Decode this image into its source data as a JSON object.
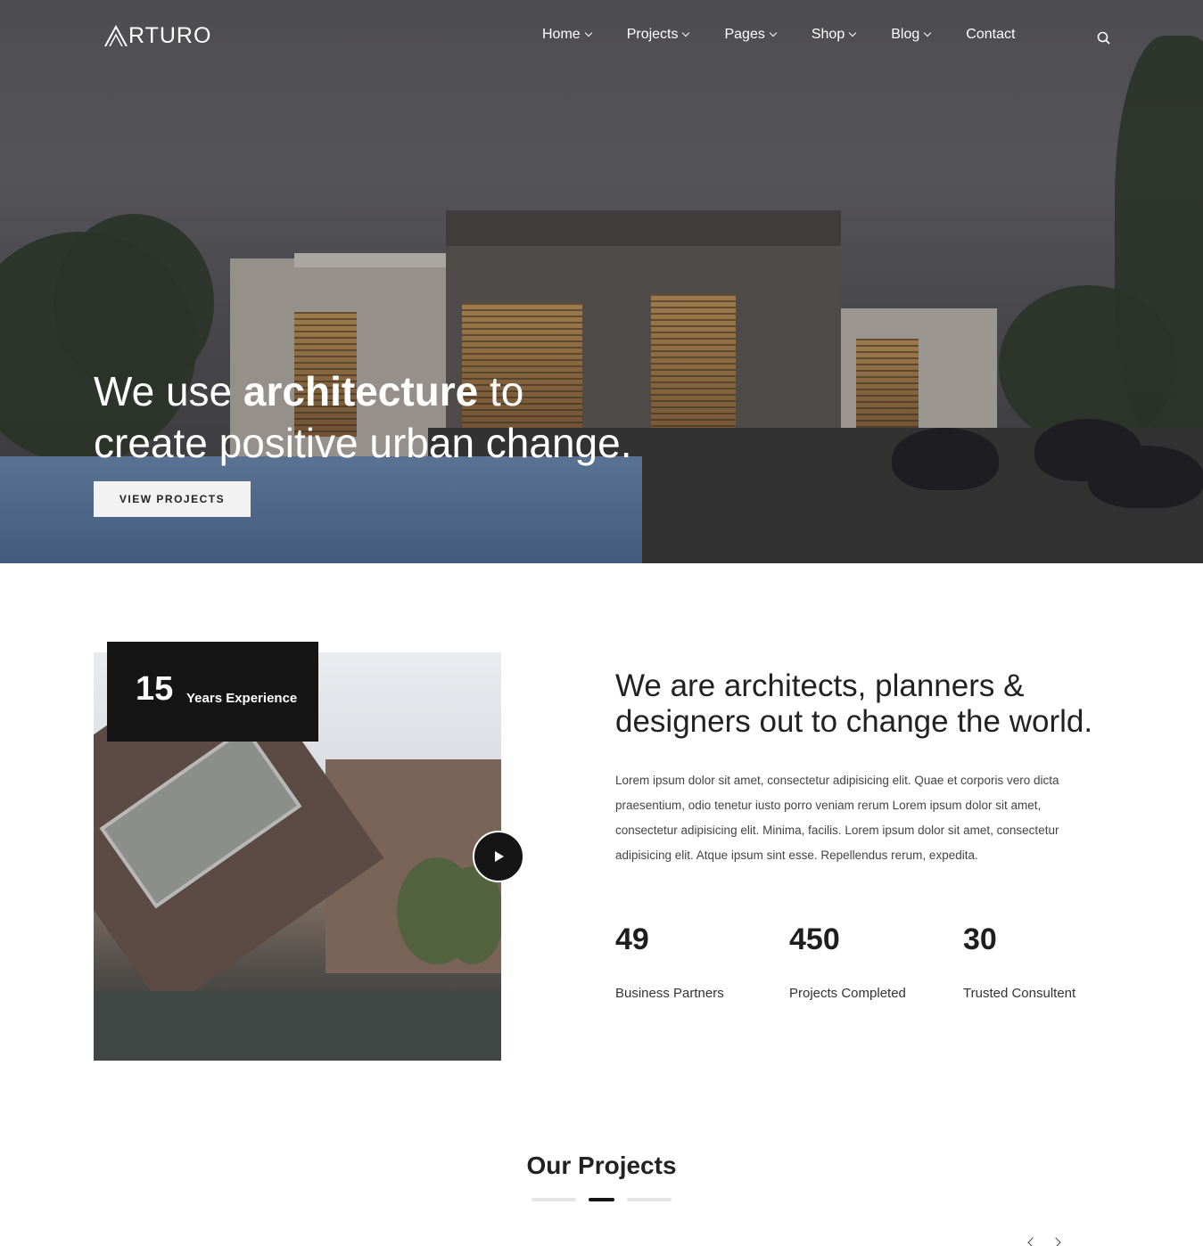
{
  "brand": {
    "logo_text": "RTURO"
  },
  "nav": {
    "items": [
      {
        "label": "Home",
        "has_dropdown": true
      },
      {
        "label": "Projects",
        "has_dropdown": true
      },
      {
        "label": "Pages",
        "has_dropdown": true
      },
      {
        "label": "Shop",
        "has_dropdown": true
      },
      {
        "label": "Blog",
        "has_dropdown": true
      },
      {
        "label": "Contact",
        "has_dropdown": false
      }
    ],
    "search_icon": "search-icon"
  },
  "hero": {
    "title_part1": "We use ",
    "title_bold": "architecture",
    "title_part2": " to",
    "title_line2": "create positive urban change.",
    "button_label": "VIEW PROJECTS"
  },
  "about": {
    "experience_number": "15",
    "experience_label": "Years Experience",
    "heading": "We are architects, planners & designers out to change the world.",
    "body": "Lorem ipsum dolor sit amet, consectetur adipisicing elit. Quae et corporis vero dicta praesentium, odio tenetur iusto porro veniam rerum Lorem ipsum dolor sit amet, consectetur adipisicing elit. Minima, facilis. Lorem ipsum dolor sit amet, consectetur adipisicing elit. Atque ipsum sint esse. Repellendus rerum, expedita.",
    "play_icon": "play-icon",
    "stats": [
      {
        "number": "49",
        "label": "Business Partners"
      },
      {
        "number": "450",
        "label": "Projects Completed"
      },
      {
        "number": "30",
        "label": "Trusted Consultent"
      }
    ]
  },
  "projects": {
    "title": "Our Projects",
    "slider_active_index": 1,
    "slider_count": 3
  },
  "colors": {
    "dark": "#151515",
    "white": "#ffffff",
    "text": "#222222"
  }
}
